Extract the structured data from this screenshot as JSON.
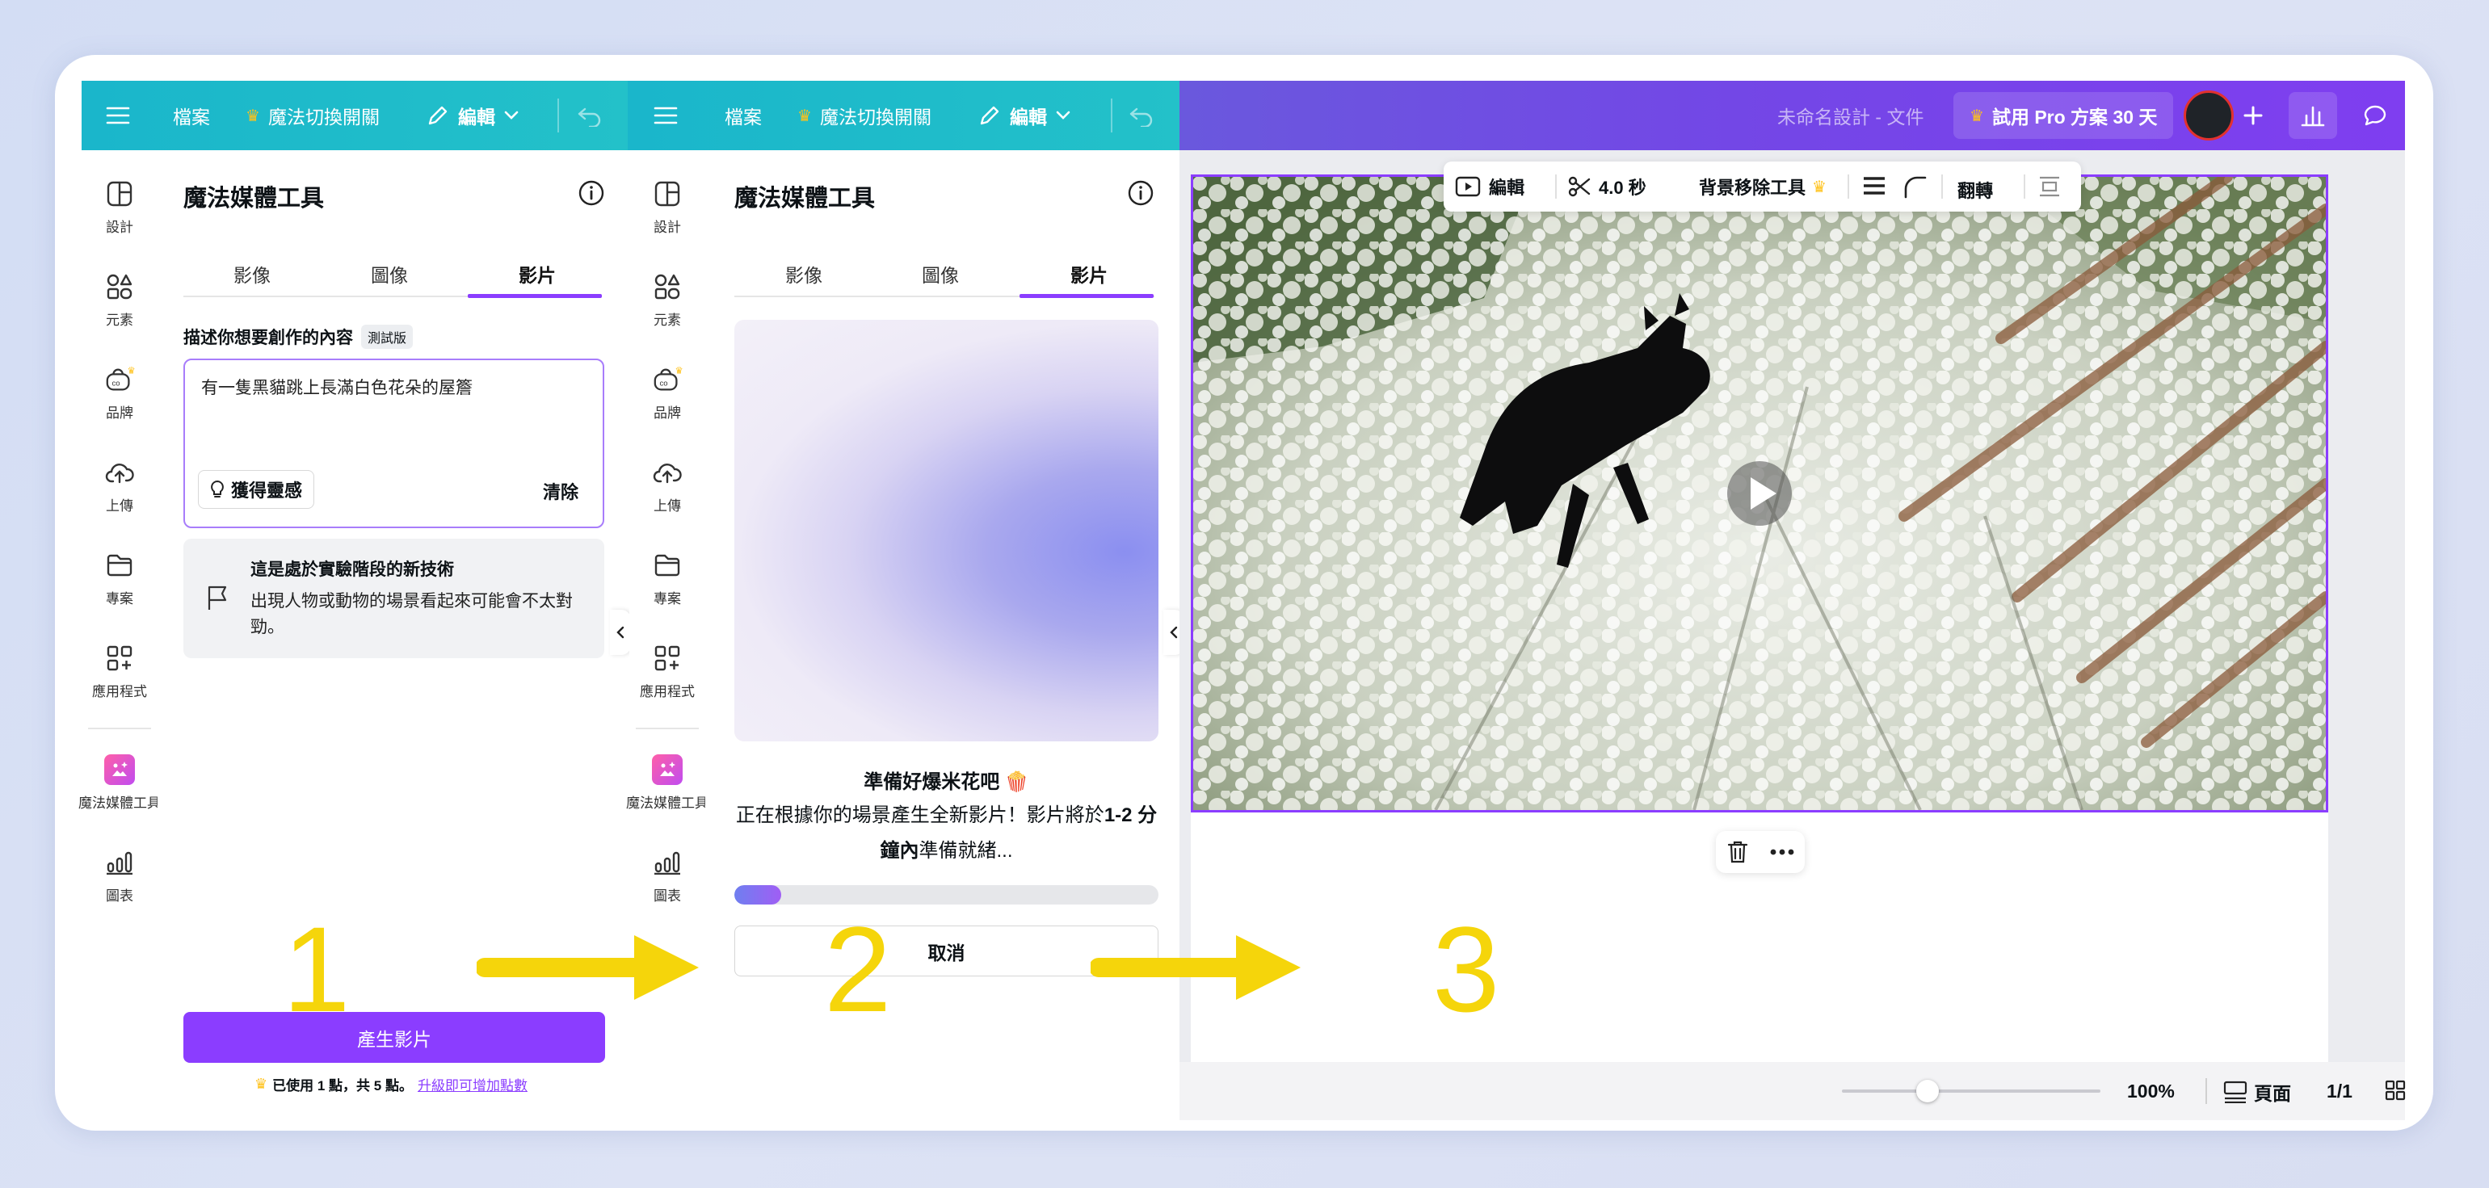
{
  "colors": {
    "purple": "#8b3dff",
    "teal": "#1ab6cb",
    "yellow_arrow": "#f5d50b",
    "selection": "#8b3dff"
  },
  "panel1": {
    "topbar": {
      "file": "檔案",
      "magic_switch": "魔法切換開關",
      "edit": "編輯"
    },
    "rail": [
      {
        "label": "設計",
        "icon": "design-icon"
      },
      {
        "label": "元素",
        "icon": "elements-icon"
      },
      {
        "label": "品牌",
        "icon": "brand-icon"
      },
      {
        "label": "上傳",
        "icon": "upload-icon"
      },
      {
        "label": "專案",
        "icon": "folder-icon"
      },
      {
        "label": "應用程式",
        "icon": "apps-icon"
      },
      {
        "label": "魔法媒體工具",
        "icon": "magic-media-icon"
      },
      {
        "label": "圖表",
        "icon": "charts-icon"
      }
    ],
    "title": "魔法媒體工具",
    "tabs": [
      "影像",
      "圖像",
      "影片"
    ],
    "prompt_label": "描述你想要創作的內容",
    "beta_badge": "測試版",
    "prompt_value": "有一隻黑貓跳上長滿白色花朵的屋簷",
    "inspire_label": "獲得靈感",
    "clear_label": "清除",
    "notice_title": "這是處於實驗階段的新技術",
    "notice_body": "出現人物或動物的場景看起來可能會不太對勁。",
    "generate_label": "產生影片",
    "usage_text": "已使用 1 點，共 5 點。",
    "upgrade_link": "升級即可增加點數",
    "step_number": "1"
  },
  "panel2": {
    "title": "魔法媒體工具",
    "tabs": [
      "影像",
      "圖像",
      "影片"
    ],
    "ready_title": "準備好爆米花吧 🍿",
    "ready_body_1": "正在根據你的場景產生全新影片！影片將於",
    "ready_body_bold": "1-2 分鐘內",
    "ready_body_2": "準備就緒...",
    "progress": 0.11,
    "cancel_label": "取消",
    "step_number": "2"
  },
  "panel3": {
    "doc_title": "未命名設計 - 文件",
    "try_pro": "試用 Pro 方案 30 天",
    "toolbar": {
      "edit": "編輯",
      "duration": "4.0 秒",
      "bg_remover": "背景移除工具",
      "flip": "翻轉"
    },
    "zoom": "100%",
    "pages_label": "頁面",
    "page_count": "1/1",
    "zoom_level": 0.33,
    "step_number": "3"
  }
}
